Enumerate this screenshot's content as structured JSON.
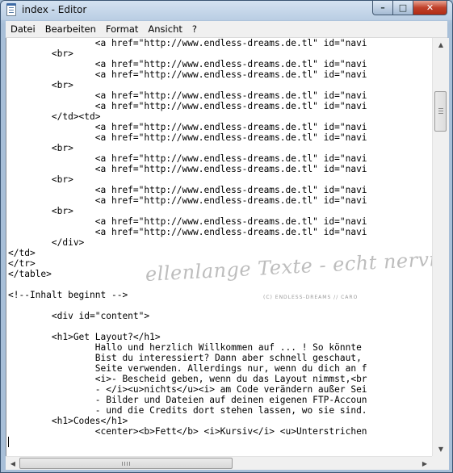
{
  "window": {
    "title": "index - Editor",
    "controls": {
      "minimize": "–",
      "maximize": "□",
      "close": "✕"
    }
  },
  "menu": {
    "items": [
      "Datei",
      "Bearbeiten",
      "Format",
      "Ansicht",
      "?"
    ]
  },
  "editor": {
    "lines": [
      "                <a href=\"http://www.endless-dreams.de.tl\" id=\"navi",
      "        <br>",
      "                <a href=\"http://www.endless-dreams.de.tl\" id=\"navi",
      "                <a href=\"http://www.endless-dreams.de.tl\" id=\"navi",
      "        <br>",
      "                <a href=\"http://www.endless-dreams.de.tl\" id=\"navi",
      "                <a href=\"http://www.endless-dreams.de.tl\" id=\"navi",
      "        </td><td>",
      "                <a href=\"http://www.endless-dreams.de.tl\" id=\"navi",
      "                <a href=\"http://www.endless-dreams.de.tl\" id=\"navi",
      "        <br>",
      "                <a href=\"http://www.endless-dreams.de.tl\" id=\"navi",
      "                <a href=\"http://www.endless-dreams.de.tl\" id=\"navi",
      "        <br>",
      "                <a href=\"http://www.endless-dreams.de.tl\" id=\"navi",
      "                <a href=\"http://www.endless-dreams.de.tl\" id=\"navi",
      "        <br>",
      "                <a href=\"http://www.endless-dreams.de.tl\" id=\"navi",
      "                <a href=\"http://www.endless-dreams.de.tl\" id=\"navi",
      "        </div>",
      "</td>",
      "</tr>",
      "</table>",
      "",
      "<!--Inhalt beginnt -->",
      "",
      "        <div id=\"content\">",
      "",
      "        <h1>Get Layout?</h1>",
      "                Hallo und herzlich Willkommen auf ... ! So könnte",
      "                Bist du interessiert? Dann aber schnell geschaut,",
      "                Seite verwenden. Allerdings nur, wenn du dich an f",
      "                <i>- Bescheid geben, wenn du das Layout nimmst,<br",
      "                - </i><u>nichts</u><i> am Code verändern außer Sei",
      "                - Bilder und Dateien auf deinen eigenen FTP-Accoun",
      "                - und die Credits dort stehen lassen, wo sie sind.",
      "        <h1>Codes</h1>",
      "                <center><b>Fett</b> <i>Kursiv</i> <u>Unterstrichen"
    ],
    "watermark": {
      "title": "ellenlange Texte - echt nervig!",
      "credit": "(C) ENDLESS-DREAMS // CARO"
    }
  }
}
